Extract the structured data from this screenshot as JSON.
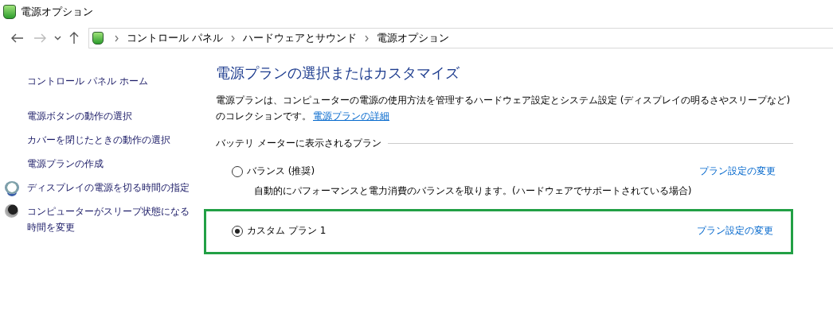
{
  "window": {
    "title": "電源オプション"
  },
  "nav": {
    "back_disabled": false,
    "forward_disabled": true
  },
  "breadcrumb": [
    "コントロール パネル",
    "ハードウェアとサウンド",
    "電源オプション"
  ],
  "sidebar": {
    "home": "コントロール パネル ホーム",
    "items": [
      {
        "label": "電源ボタンの動作の選択",
        "kind": "plain"
      },
      {
        "label": "カバーを閉じたときの動作の選択",
        "kind": "plain"
      },
      {
        "label": "電源プランの作成",
        "kind": "plain"
      },
      {
        "label": "ディスプレイの電源を切る時間の指定",
        "kind": "display"
      },
      {
        "label": "コンピューターがスリープ状態になる時間を変更",
        "kind": "sleep"
      }
    ]
  },
  "main": {
    "heading": "電源プランの選択またはカスタマイズ",
    "description": "電源プランは、コンピューターの電源の使用方法を管理するハードウェア設定とシステム設定 (ディスプレイの明るさやスリープなど) のコレクションです。",
    "description_link": "電源プランの詳細",
    "group_label": "バッテリ メーターに表示されるプラン",
    "plans": [
      {
        "name": "バランス (推奨)",
        "selected": false,
        "highlighted": false,
        "link": "プラン設定の変更",
        "detail": "自動的にパフォーマンスと電力消費のバランスを取ります。(ハードウェアでサポートされている場合)"
      },
      {
        "name": "カスタム プラン 1",
        "selected": true,
        "highlighted": true,
        "link": "プラン設定の変更"
      }
    ]
  }
}
